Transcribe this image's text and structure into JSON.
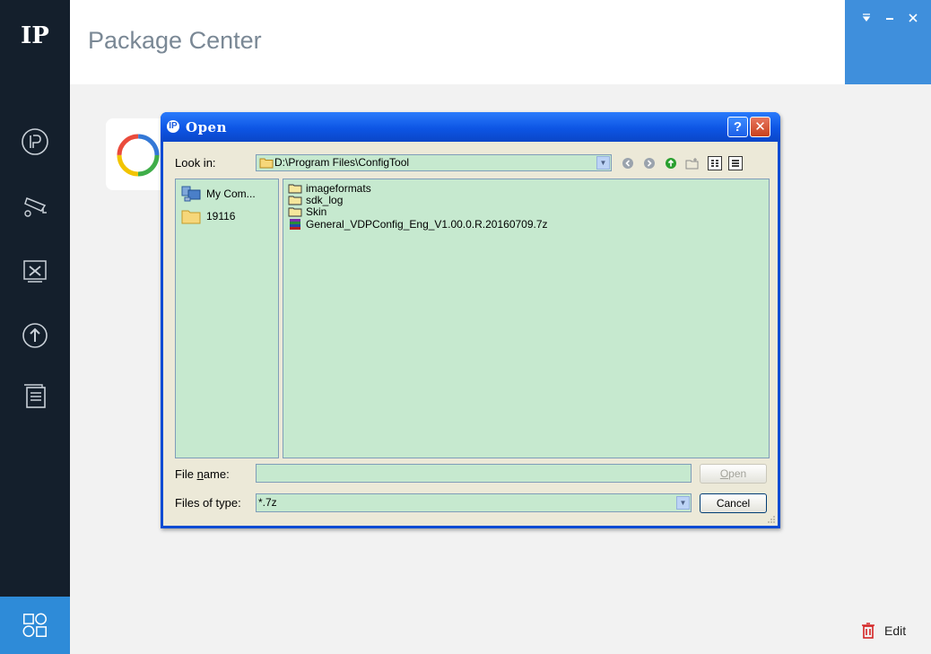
{
  "sidebar": {
    "logo_text": "IP",
    "items": [
      {
        "icon": "ip-device-icon"
      },
      {
        "icon": "camera-config-icon"
      },
      {
        "icon": "tools-icon"
      },
      {
        "icon": "upgrade-icon"
      },
      {
        "icon": "document-icon"
      },
      {
        "icon": "package-center-icon"
      }
    ]
  },
  "header": {
    "title": "Package Center"
  },
  "footer": {
    "edit_label": "Edit"
  },
  "dialog": {
    "title": "Open",
    "look_in_label": "Look in:",
    "look_in_path": "D:\\Program Files\\ConfigTool",
    "places": [
      {
        "label": "My Com...",
        "icon": "my-computer-icon"
      },
      {
        "label": "19116",
        "icon": "folder-icon"
      }
    ],
    "files": [
      {
        "name": "imageformats",
        "type": "folder"
      },
      {
        "name": "sdk_log",
        "type": "folder"
      },
      {
        "name": "Skin",
        "type": "folder"
      },
      {
        "name": "General_VDPConfig_Eng_V1.00.0.R.20160709.7z",
        "type": "archive"
      }
    ],
    "file_name_label_pre": "File ",
    "file_name_label_u": "n",
    "file_name_label_post": "ame:",
    "file_name_value": "",
    "files_of_type_label": "Files of type:",
    "files_of_type_value": "*.7z",
    "open_label_u": "O",
    "open_label_rest": "pen",
    "cancel_label": "Cancel",
    "help_glyph": "?",
    "close_glyph": "✕"
  },
  "colors": {
    "sidebar_bg": "#141f2c",
    "accent": "#2e8bd8",
    "dialog_title": "#0d55e4",
    "list_bg": "#c6e9cf"
  }
}
